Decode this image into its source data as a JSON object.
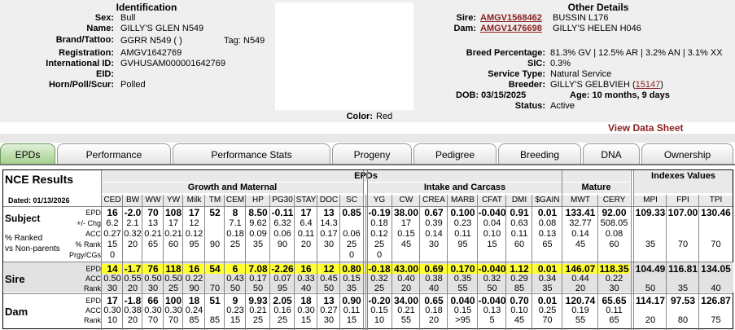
{
  "identification": {
    "heading": "Identification",
    "sex_label": "Sex:",
    "sex": "Bull",
    "name_label": "Name:",
    "name": "GILLY'S GLEN N549",
    "brand_label": "Brand/Tattoo:",
    "brand": "GGRR N549 ( )",
    "tag_label": "Tag:",
    "tag": "N549",
    "reg_label": "Registration:",
    "reg": "AMGV1642769",
    "intl_label": "International ID:",
    "intl": "GVHUSAM000001642769",
    "eid_label": "EID:",
    "eid": "",
    "horn_label": "Horn/Poll/Scur:",
    "horn": "Polled",
    "color_label": "Color:",
    "color": "Red"
  },
  "other": {
    "heading": "Other Details",
    "sire_label": "Sire:",
    "sire_reg": "AMGV1568462",
    "sire_name": "BUSSIN L176",
    "dam_label": "Dam:",
    "dam_reg": "AMGV1476698",
    "dam_name": "GILLY'S HELEN H046",
    "breed_label": "Breed Percentage:",
    "breed": "81.3% GV | 12.5% AR | 3.2% AN | 3.1% XX",
    "sic_label": "SIC:",
    "sic": "0.3%",
    "service_label": "Service Type:",
    "service": "Natural Service",
    "breeder_label": "Breeder:",
    "breeder": "GILLY'S GELBVIEH (",
    "breeder_id": "15147",
    "breeder_close": ")",
    "dob": "DOB: 03/15/2025",
    "age": "Age: 10 months, 9 days",
    "status_label": "Status:",
    "status": "Active",
    "view_ds": "View Data Sheet"
  },
  "tabs": [
    "EPDs",
    "Performance",
    "Performance Stats",
    "Progeny",
    "Pedigree",
    "Breeding",
    "DNA",
    "Ownership"
  ],
  "table": {
    "title": "NCE Results",
    "dated": "Dated: 01/13/2026",
    "epds_heading": "EPDs",
    "indexes_heading": "Indexes Values",
    "growth": "Growth and Maternal",
    "intake": "Intake and Carcass",
    "mature": "Mature",
    "cols": [
      "CED",
      "BW",
      "WW",
      "YW",
      "Milk",
      "TM",
      "CEM",
      "HP",
      "PG30",
      "STAY",
      "DOC",
      "SC",
      "YG",
      "CW",
      "CREA",
      "MARB",
      "CFAT",
      "DMI",
      "$GAIN",
      "MWT",
      "CERY",
      "MPI",
      "FPI",
      "TPI"
    ],
    "subject_label": "Subject",
    "pct_label1": "% Ranked",
    "pct_label2": "vs Non-parents",
    "sire_label": "Sire",
    "dam_label": "Dam",
    "sub_labels": [
      "EPD",
      "+/- Chg",
      "ACC",
      "% Rank",
      "Prgy/CGs"
    ],
    "short_labels": [
      "EPD",
      "ACC",
      "Rank"
    ],
    "subject": {
      "epd": [
        "16",
        "-2.0",
        "70",
        "108",
        "17",
        "52",
        "8",
        "8.50",
        "-0.11",
        "17",
        "13",
        "0.85",
        "-0.19",
        "38.00",
        "0.67",
        "0.100",
        "-0.040",
        "0.91",
        "0.01",
        "133.41",
        "92.00",
        "109.33",
        "107.00",
        "130.46"
      ],
      "chg": [
        "6.2",
        "2.1",
        "13",
        "17",
        "12",
        "",
        "7.1",
        "9.62",
        "6.32",
        "6.4",
        "14.3",
        "",
        "0.18",
        "17",
        "0.39",
        "0.23",
        "0.04",
        "0.63",
        "0.08",
        "32.77",
        "508.05",
        "",
        "",
        ""
      ],
      "acc": [
        "0.27",
        "0.32",
        "0.21",
        "0.21",
        "0.12",
        "",
        "0.18",
        "0.09",
        "0.06",
        "0.11",
        "0.17",
        "0.06",
        "0.12",
        "0.15",
        "0.14",
        "0.11",
        "0.10",
        "0.11",
        "0.13",
        "0.14",
        "0.08",
        "",
        "",
        ""
      ],
      "rank": [
        "15",
        "20",
        "65",
        "60",
        "95",
        "90",
        "25",
        "35",
        "90",
        "20",
        "30",
        "25",
        "25",
        "45",
        "30",
        "95",
        "15",
        "60",
        "65",
        "45",
        "60",
        "35",
        "70",
        "70"
      ],
      "prgy": [
        "0",
        "",
        "",
        "",
        "",
        "",
        "",
        "",
        "",
        "",
        "",
        "0",
        "0",
        "",
        "",
        "",
        "",
        "",
        "",
        "",
        "",
        "",
        "",
        ""
      ]
    },
    "sire": {
      "epd": [
        "14",
        "-1.7",
        "76",
        "118",
        "16",
        "54",
        "6",
        "7.08",
        "-2.26",
        "16",
        "12",
        "0.80",
        "-0.18",
        "43.00",
        "0.69",
        "0.170",
        "-0.040",
        "1.12",
        "0.01",
        "146.07",
        "118.35",
        "104.49",
        "116.81",
        "134.05"
      ],
      "acc": [
        "0.50",
        "0.55",
        "0.50",
        "0.50",
        "0.22",
        "",
        "0.43",
        "0.17",
        "0.07",
        "0.33",
        "0.45",
        "0.15",
        "0.32",
        "0.40",
        "0.38",
        "0.35",
        "0.32",
        "0.29",
        "0.34",
        "0.44",
        "0.22",
        "",
        "",
        ""
      ],
      "rank": [
        "30",
        "20",
        "30",
        "25",
        "90",
        "70",
        "50",
        "50",
        "95",
        "40",
        "50",
        "35",
        "25",
        "20",
        "40",
        "55",
        "50",
        "85",
        "35",
        "20",
        "30",
        "50",
        "35",
        "40"
      ]
    },
    "dam": {
      "epd": [
        "17",
        "-1.8",
        "66",
        "100",
        "18",
        "51",
        "9",
        "9.93",
        "2.05",
        "18",
        "13",
        "0.90",
        "-0.20",
        "34.00",
        "0.65",
        "0.040",
        "-0.040",
        "0.70",
        "0.01",
        "120.74",
        "65.65",
        "114.17",
        "97.53",
        "126.87"
      ],
      "acc": [
        "0.30",
        "0.38",
        "0.30",
        "0.30",
        "0.24",
        "",
        "0.23",
        "0.21",
        "0.16",
        "0.30",
        "0.27",
        "0.11",
        "0.15",
        "0.21",
        "0.18",
        "0.15",
        "0.13",
        "0.10",
        "0.25",
        "0.19",
        "0.11",
        "",
        "",
        ""
      ],
      "rank": [
        "10",
        "20",
        "70",
        "70",
        "85",
        "85",
        "15",
        "25",
        "25",
        "15",
        "30",
        "15",
        "10",
        "55",
        "20",
        ">95",
        "5",
        "45",
        "70",
        "55",
        "65",
        "20",
        "80",
        "75"
      ]
    }
  },
  "colors": {
    "link": "#8b2020",
    "highlight": "#ffff33",
    "tab_active": "#a6d08e",
    "panel": "#efefef"
  }
}
